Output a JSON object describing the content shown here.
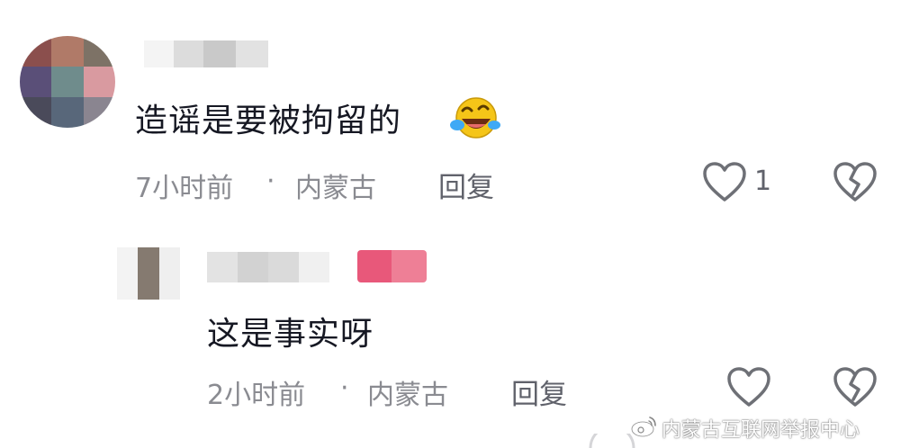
{
  "comments": [
    {
      "text": "造谣是要被拘留的",
      "time": "7小时前",
      "separator": "·",
      "location": "内蒙古",
      "reply_label": "回复",
      "like_count": "1",
      "emoji": "laughing-tears-emoji"
    },
    {
      "text": "这是事实呀",
      "time": "2小时前",
      "separator": "·",
      "location": "内蒙古",
      "reply_label": "回复"
    }
  ],
  "watermark": {
    "text": "内蒙古互联网举报中心",
    "icon": "weibo-icon"
  },
  "colors": {
    "meta_gray": "#8a8b91",
    "author_badge": "#e8587a",
    "text": "#161823"
  }
}
